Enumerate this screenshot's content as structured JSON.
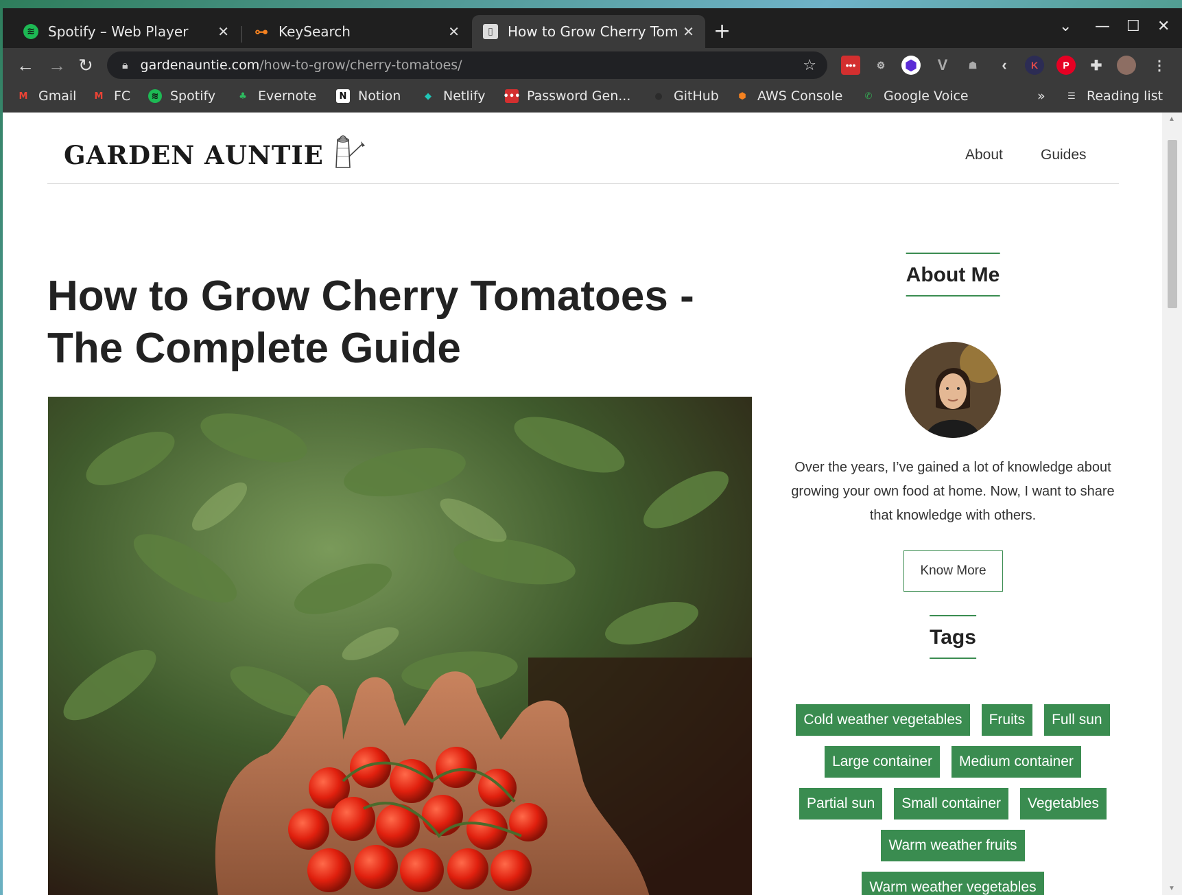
{
  "browser": {
    "tabs": [
      {
        "title": "Spotify – Web Player",
        "favicon": "spotify-icon",
        "color": "#1db954"
      },
      {
        "title": "KeySearch",
        "favicon": "keysearch-icon",
        "color": "#f58220"
      },
      {
        "title": "How to Grow Cherry Toma",
        "favicon": "page-icon",
        "color": "#cccccc"
      }
    ],
    "url_host": "gardenauntie.com",
    "url_path": "/how-to-grow/cherry-tomatoes/",
    "bookmarks": [
      {
        "label": "Gmail",
        "icon": "gmail-icon",
        "color": "#ea4335"
      },
      {
        "label": "FC",
        "icon": "gmail-icon",
        "color": "#ea4335"
      },
      {
        "label": "Spotify",
        "icon": "spotify-icon",
        "color": "#1db954"
      },
      {
        "label": "Evernote",
        "icon": "evernote-icon",
        "color": "#2dbe60"
      },
      {
        "label": "Notion",
        "icon": "notion-icon",
        "color": "#ffffff"
      },
      {
        "label": "Netlify",
        "icon": "netlify-icon",
        "color": "#20c6b7"
      },
      {
        "label": "Password Gen...",
        "icon": "password-icon",
        "color": "#d32f2f"
      },
      {
        "label": "GitHub",
        "icon": "github-icon",
        "color": "#2b2b2b"
      },
      {
        "label": "AWS Console",
        "icon": "aws-icon",
        "color": "#f58220"
      },
      {
        "label": "Google Voice",
        "icon": "voice-icon",
        "color": "#34a853"
      }
    ],
    "bookmarks_overflow": "»",
    "reading_list": "Reading list"
  },
  "site": {
    "logo": "GARDEN AUNTIE",
    "nav": [
      "About",
      "Guides"
    ],
    "accent": "#3a8c50"
  },
  "article": {
    "title": "How to Grow Cherry Tomatoes - The Complete Guide"
  },
  "sidebar": {
    "about_heading": "About Me",
    "about_text": "Over the years, I’ve gained a lot of knowledge about growing your own food at home. Now, I want to share that knowledge with others.",
    "know_more": "Know More",
    "tags_heading": "Tags",
    "tags": [
      [
        "Cold weather vegetables",
        "Fruits",
        "Full sun"
      ],
      [
        "Large container",
        "Medium container"
      ],
      [
        "Partial sun",
        "Small container",
        "Vegetables"
      ],
      [
        "Warm weather fruits"
      ],
      [
        "Warm weather vegetables"
      ]
    ]
  }
}
